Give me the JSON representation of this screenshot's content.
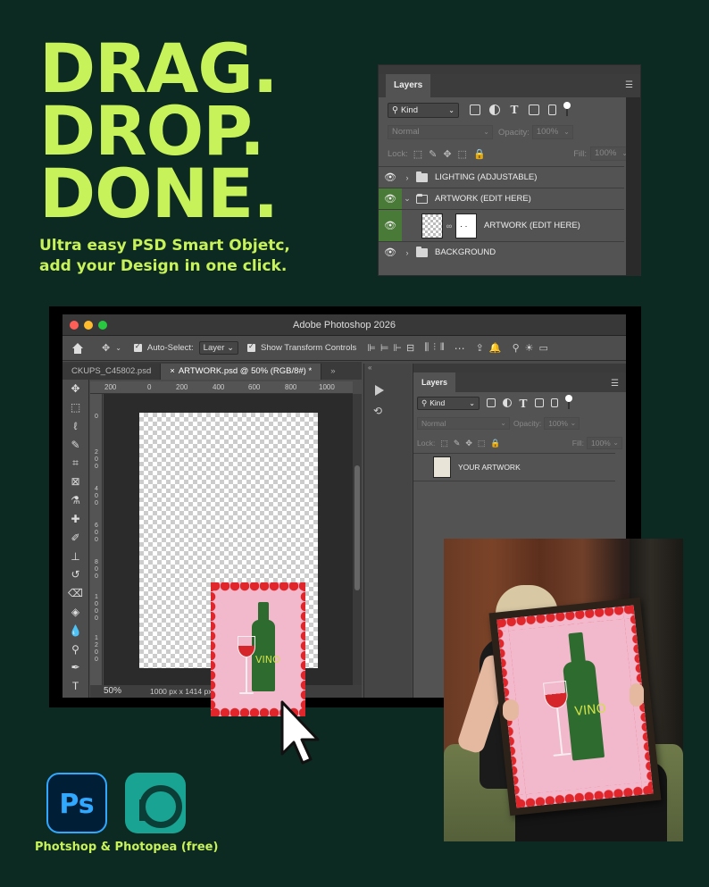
{
  "headline": {
    "line1": "DRAG.",
    "line2": "DROP.",
    "line3": "DONE.",
    "subtitle_line1": "Ultra easy PSD Smart Objetc,",
    "subtitle_line2": "add your Design in one click."
  },
  "layers_panel_top": {
    "tab": "Layers",
    "kind_label": "Kind",
    "blend_mode": "Normal",
    "opacity_label": "Opacity:",
    "opacity_value": "100%",
    "lock_label": "Lock:",
    "fill_label": "Fill:",
    "fill_value": "100%",
    "layers": [
      {
        "name": "LIGHTING (ADJUSTABLE)",
        "type": "group",
        "expanded": false
      },
      {
        "name": "ARTWORK (EDIT HERE)",
        "type": "group",
        "expanded": true
      },
      {
        "name": "ARTWORK (EDIT HERE)",
        "type": "smart-object",
        "selected": true
      },
      {
        "name": "BACKGROUND",
        "type": "group",
        "expanded": false
      }
    ]
  },
  "photoshop": {
    "window_title": "Adobe Photoshop 2026",
    "options": {
      "auto_select_label": "Auto-Select:",
      "auto_select_value": "Layer",
      "transform_controls_label": "Show Transform Controls"
    },
    "tabs": [
      {
        "label": "CKUPS_C45802.psd",
        "active": false
      },
      {
        "label": "ARTWORK.psd @ 50% (RGB/8#) *",
        "active": true
      }
    ],
    "ruler_top": [
      "200",
      "0",
      "200",
      "400",
      "600",
      "800",
      "1000"
    ],
    "ruler_left": [
      "0",
      "2\n0\n0",
      "4\n0\n0",
      "6\n0\n0",
      "8\n0\n0",
      "1\n0\n0\n0",
      "1\n2\n0\n0"
    ],
    "zoom": "50%",
    "doc_size": "1000 px x 1414 px",
    "layers_panel": {
      "tab": "Layers",
      "kind_label": "Kind",
      "blend_mode": "Normal",
      "opacity_label": "Opacity:",
      "opacity_value": "100%",
      "lock_label": "Lock:",
      "fill_label": "Fill:",
      "fill_value": "100%",
      "layers": [
        {
          "name": "YOUR ARTWORK"
        }
      ]
    }
  },
  "poster": {
    "text": "VINO"
  },
  "apps": {
    "ps_label": "Ps",
    "caption": "Photshop & Photopea (free)"
  },
  "colors": {
    "background": "#0c2a22",
    "accent": "#c8f25a",
    "poster_pink": "#f2b8cc",
    "poster_red": "#e0262b",
    "bottle_green": "#2e6b2f"
  }
}
